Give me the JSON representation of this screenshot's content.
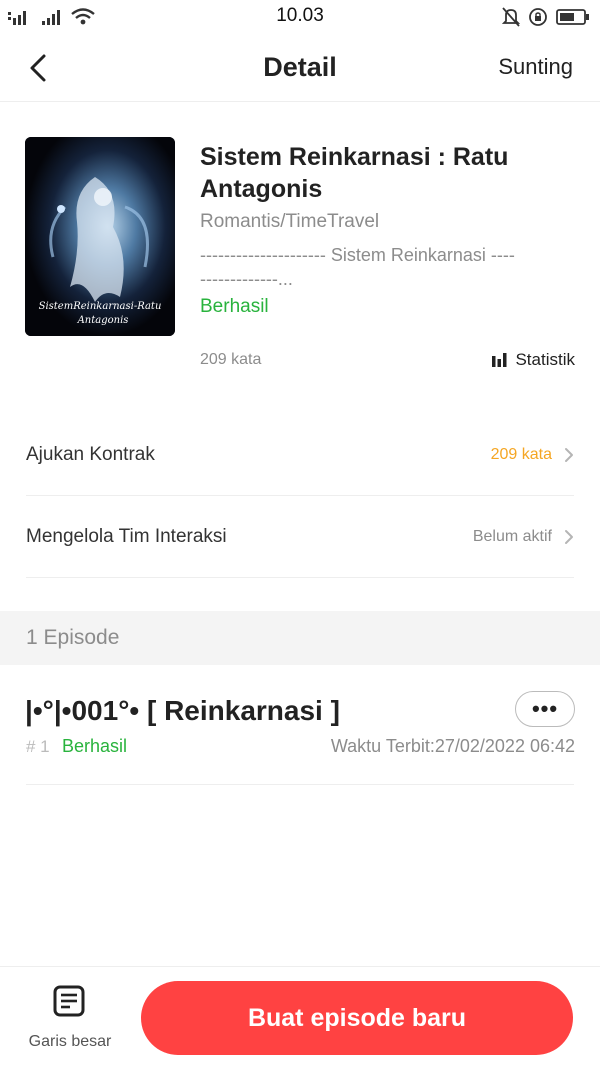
{
  "status_bar": {
    "time": "10.03"
  },
  "nav": {
    "title": "Detail",
    "edit_label": "Sunting"
  },
  "book": {
    "title": "Sistem Reinkarnasi : Ratu Antagonis",
    "cover_text_line1": "SistemReinkarnasi-Ratu",
    "cover_text_line2": "Antagonis",
    "genre": "Romantis/TimeTravel",
    "synopsis": "--------------------- Sistem Reinkarnasi -----------------...",
    "status": "Berhasil",
    "word_count": "209 kata",
    "stats_label": "Statistik"
  },
  "rows": {
    "contract": {
      "label": "Ajukan Kontrak",
      "value": "209 kata",
      "value_color": "#f5a623"
    },
    "team": {
      "label": "Mengelola Tim Interaksi",
      "value": "Belum aktif",
      "value_color": "#8c8c8c"
    }
  },
  "episodes_section": {
    "label": "1 Episode"
  },
  "episode": {
    "title": "|•°|•001°• [ Reinkarnasi ]",
    "number": "# 1",
    "status": "Berhasil",
    "publish_time": "Waktu Terbit:27/02/2022 06:42",
    "more_label": "•••"
  },
  "bottom": {
    "outline_label": "Garis besar",
    "new_episode_label": "Buat episode baru"
  },
  "icons": {
    "back": "chevron-left-icon",
    "stats": "bar-chart-icon",
    "row_arrow": "chevron-right-icon",
    "outline": "document-list-icon"
  },
  "colors": {
    "accent_red": "#ff4242",
    "success_green": "#29b33d",
    "warning_orange": "#f5a623"
  }
}
